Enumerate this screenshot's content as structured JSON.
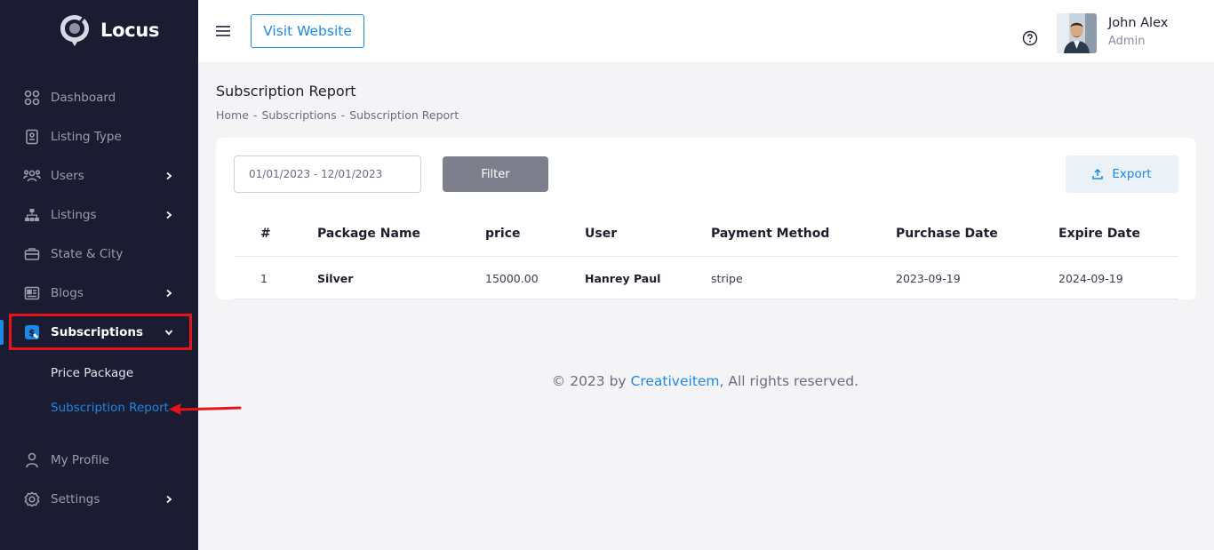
{
  "app": {
    "name": "Locus"
  },
  "sidebar": {
    "items": [
      {
        "label": "Dashboard",
        "icon": "grid-icon"
      },
      {
        "label": "Listing Type",
        "icon": "document-icon"
      },
      {
        "label": "Users",
        "icon": "users-icon"
      },
      {
        "label": "Listings",
        "icon": "hierarchy-icon"
      },
      {
        "label": "State & City",
        "icon": "briefcase-icon"
      },
      {
        "label": "Blogs",
        "icon": "newspaper-icon"
      },
      {
        "label": "Subscriptions",
        "icon": "subscription-icon"
      },
      {
        "label": "My Profile",
        "icon": "user-icon"
      },
      {
        "label": "Settings",
        "icon": "gear-icon"
      }
    ],
    "sub_items": [
      {
        "label": "Price Package"
      },
      {
        "label": "Subscription Report"
      }
    ]
  },
  "header": {
    "visit_label": "Visit Website",
    "user_name": "John Alex",
    "user_role": "Admin"
  },
  "page": {
    "title": "Subscription Report",
    "breadcrumb": [
      "Home",
      "-",
      "Subscriptions",
      "-",
      "Subscription Report"
    ]
  },
  "filter": {
    "date_range": "01/01/2023 - 12/01/2023",
    "filter_label": "Filter",
    "export_label": "Export"
  },
  "table": {
    "headers": [
      "#",
      "Package Name",
      "price",
      "User",
      "Payment Method",
      "Purchase Date",
      "Expire Date"
    ],
    "rows": [
      [
        "1",
        "Silver",
        "15000.00",
        "Hanrey Paul",
        "stripe",
        "2023-09-19",
        "2024-09-19"
      ]
    ]
  },
  "footer": {
    "prefix": "© 2023 by ",
    "brand": "Creativeitem",
    "suffix": ", All rights reserved."
  },
  "colors": {
    "sidebar_bg": "#1b1c31",
    "accent": "#1e88e5",
    "annotation": "#e5141c"
  }
}
